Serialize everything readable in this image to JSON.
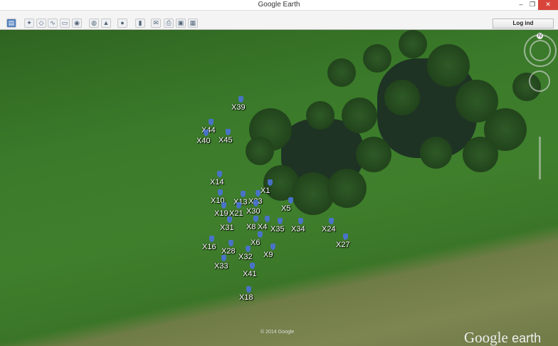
{
  "window": {
    "title": "Google Earth",
    "buttons": [
      "minimize",
      "restore",
      "close"
    ]
  },
  "toolbar": {
    "icons": [
      "sidebar-icon",
      "placemark-icon",
      "polygon-icon",
      "path-icon",
      "overlay-icon",
      "tour-icon",
      "earth-icon",
      "sun-icon",
      "planet-icon",
      "ruler-icon",
      "email-icon",
      "print-icon",
      "save-image-icon",
      "maps-icon"
    ],
    "login_label": "Log ind"
  },
  "map": {
    "markers": [
      "X39",
      "X44",
      "X40",
      "X45",
      "X14",
      "X1",
      "X10",
      "X13",
      "X23",
      "X5",
      "X19",
      "X21",
      "X30",
      "X31",
      "X8",
      "X4",
      "X35",
      "X34",
      "X24",
      "X27",
      "X6",
      "X16",
      "X28",
      "X9",
      "X32",
      "X33",
      "X41",
      "X18"
    ],
    "copyright": "© 2014 Google",
    "logo": "Google earth",
    "compass_north": "N"
  }
}
